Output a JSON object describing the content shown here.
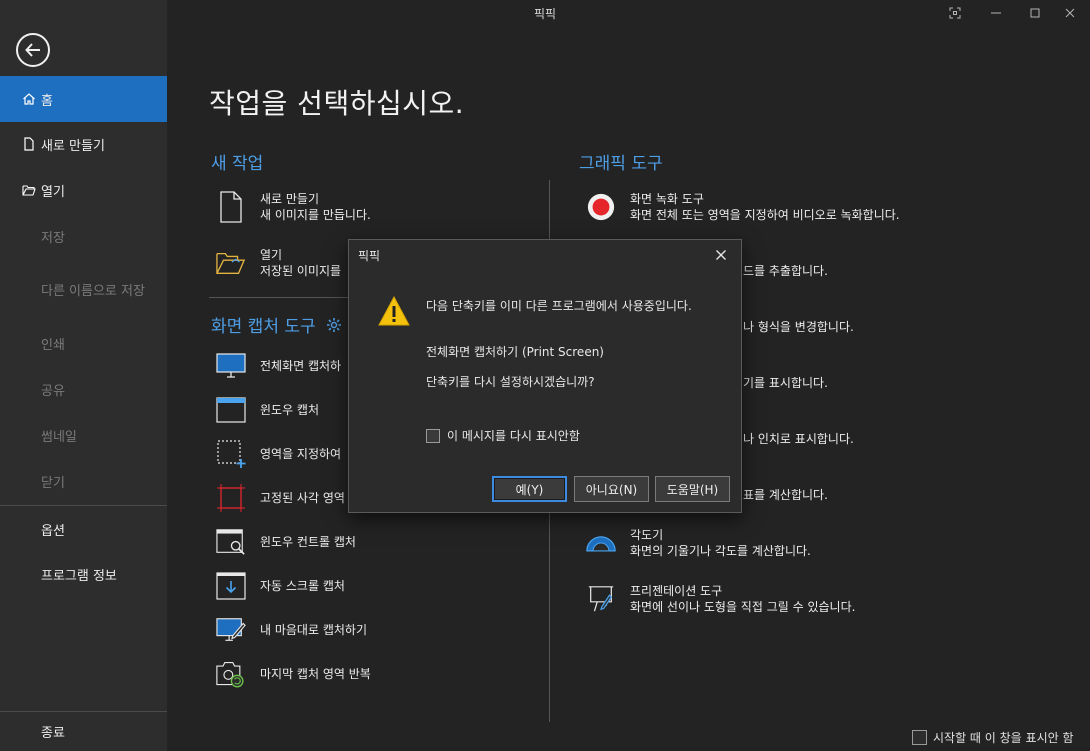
{
  "window": {
    "title": "픽픽"
  },
  "sidebar": {
    "items": [
      {
        "label": "홈"
      },
      {
        "label": "새로 만들기"
      },
      {
        "label": "열기"
      },
      {
        "label": "저장"
      },
      {
        "label": "다른 이름으로 저장"
      },
      {
        "label": "인쇄"
      },
      {
        "label": "공유"
      },
      {
        "label": "썸네일"
      },
      {
        "label": "닫기"
      },
      {
        "label": "옵션"
      },
      {
        "label": "프로그램 정보"
      },
      {
        "label": "종료"
      }
    ]
  },
  "main": {
    "heading": "작업을 선택하십시오.",
    "new_task": {
      "title": "새 작업",
      "items": [
        {
          "name": "새로 만들기",
          "desc": "새 이미지를 만듭니다."
        },
        {
          "name": "열기",
          "desc": "저장된 이미지를"
        }
      ]
    },
    "capture": {
      "title": "화면 캡처 도구",
      "items": [
        {
          "name": "전체화면 캡처하"
        },
        {
          "name": "윈도우 캡처"
        },
        {
          "name": "영역을 지정하여"
        },
        {
          "name": "고정된 사각 영역"
        },
        {
          "name": "윈도우 컨트롤 캡처"
        },
        {
          "name": "자동 스크롤 캡처"
        },
        {
          "name": "내 마음대로 캡처하기"
        },
        {
          "name": "마지막 캡처 영역 반복"
        }
      ]
    },
    "graphic": {
      "title": "그래픽 도구",
      "items": [
        {
          "name": "화면 녹화 도구",
          "desc": "화면 전체 또는 영역을 지정하여 비디오로 녹화합니다."
        },
        {
          "desc": "드를 추출합니다."
        },
        {
          "desc": "나 형식을 변경합니다."
        },
        {
          "desc": "기를 표시합니다."
        },
        {
          "desc": "나 인치로 표시합니다."
        },
        {
          "desc": "표를 계산합니다."
        },
        {
          "name": "각도기",
          "desc": "화면의 기울기나 각도를 계산합니다."
        },
        {
          "name": "프리젠테이션 도구",
          "desc": "화면에 선이나 도형을 직접 그릴 수 있습니다."
        }
      ]
    },
    "bottom_checkbox": "시작할 때 이 창을 표시안 함"
  },
  "dialog": {
    "title": "픽픽",
    "message": "다음 단축키를 이미 다른 프로그램에서 사용중입니다.",
    "shortcut": "전체화면 캡처하기 (Print Screen)",
    "question": "단축키를 다시 설정하시겠습니까?",
    "checkbox": "이 메시지를 다시 표시안함",
    "buttons": {
      "yes": "예(Y)",
      "no": "아니요(N)",
      "help": "도움말(H)"
    }
  },
  "colors": {
    "accent": "#1e6fbf",
    "section_title": "#4e9ee6",
    "record_red": "#e5262b",
    "warning": "#f4c20d",
    "blue_icon": "#4aa3ee"
  }
}
